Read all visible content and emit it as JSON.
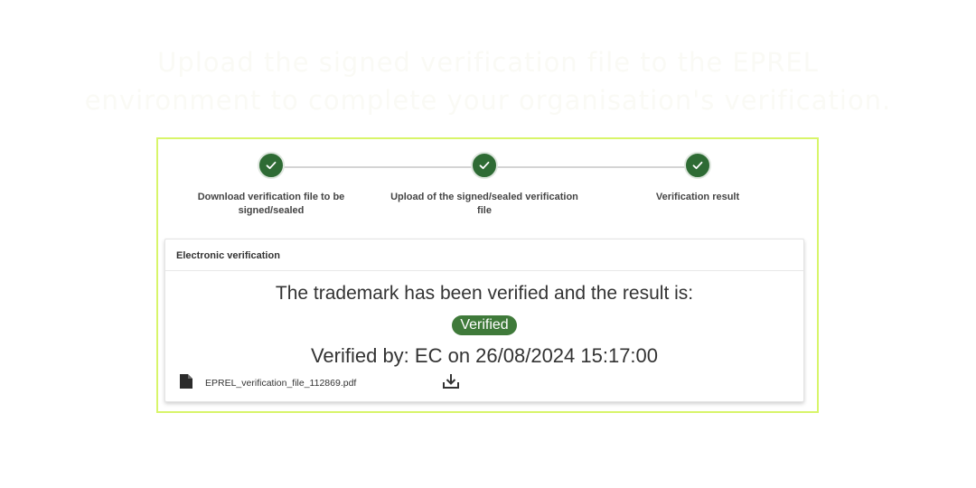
{
  "headline": {
    "line1": "Upload the signed verification file to the EPREL",
    "line2": "environment to complete your organisation's verification."
  },
  "stepper": {
    "steps": [
      {
        "label": "Download verification file to be signed/sealed",
        "status": "completed",
        "icon": "check-icon"
      },
      {
        "label": "Upload of the signed/sealed verification file",
        "status": "completed",
        "icon": "check-icon"
      },
      {
        "label": "Verification result",
        "status": "completed",
        "icon": "check-icon"
      }
    ]
  },
  "card": {
    "title": "Electronic verification",
    "result_text": "The trademark has been verified and the result is:",
    "badge": "Verified",
    "verified_by": "Verified by: EC on 26/08/2024 15:17:00",
    "file": {
      "name": "EPREL_verification_file_112869.pdf",
      "icon": "file-icon",
      "action_icon": "download-icon"
    }
  },
  "colors": {
    "step_complete": "#2e6b34",
    "badge_bg": "#3f7a3a",
    "frame_highlight": "#d8f56a"
  }
}
